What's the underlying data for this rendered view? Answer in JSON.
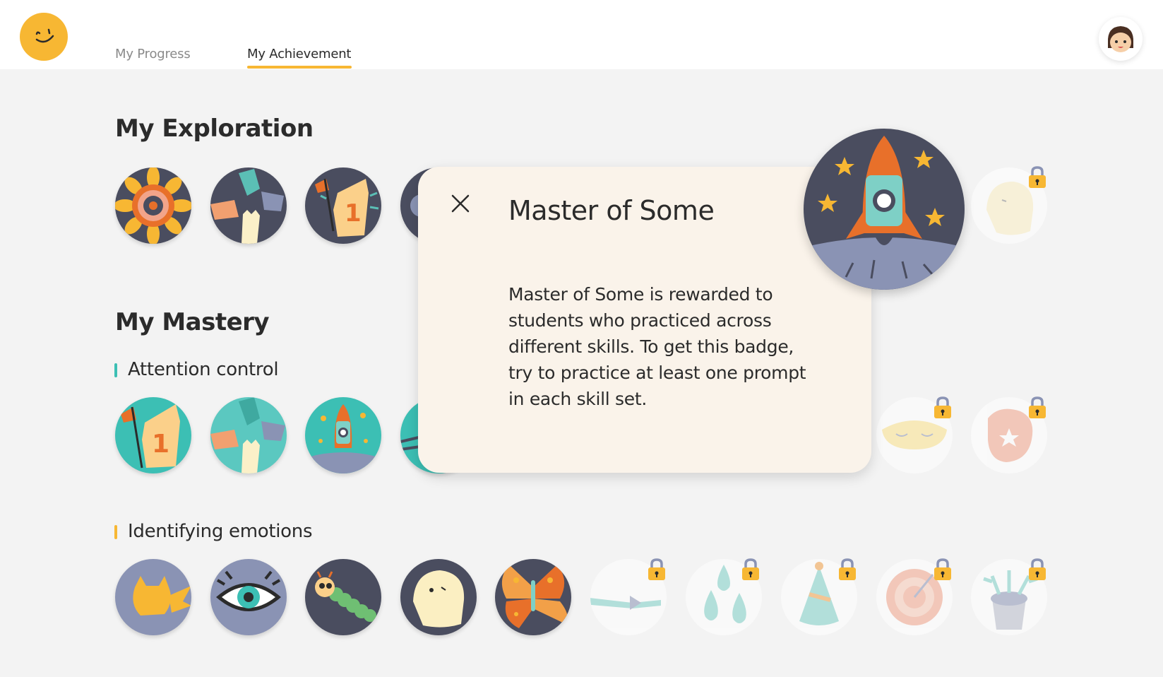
{
  "header": {
    "logo_icon": "smiley-logo-icon",
    "tabs": [
      {
        "label": "My Progress",
        "active": false
      },
      {
        "label": "My Achievement",
        "active": true
      }
    ],
    "avatar_icon": "student-avatar-icon",
    "accent_color": "#f7b733"
  },
  "exploration": {
    "title": "My Exploration",
    "badges": [
      {
        "icon": "sun-target-badge-icon",
        "locked": false
      },
      {
        "icon": "hands-badge-icon",
        "locked": false
      },
      {
        "icon": "foam-finger-badge-icon",
        "locked": false
      },
      {
        "icon": "partially-hidden-badge-icon",
        "locked": false
      },
      {
        "icon": "ghost-badge-icon",
        "locked": true
      }
    ]
  },
  "mastery": {
    "title": "My Mastery",
    "groups": [
      {
        "label": "Attention control",
        "bar_color": "#3cbfb4",
        "badges": [
          {
            "icon": "foam-finger-badge-icon",
            "locked": false
          },
          {
            "icon": "hands-badge-icon",
            "locked": false
          },
          {
            "icon": "rocket-badge-icon",
            "locked": false
          },
          {
            "icon": "partially-hidden-badge-icon",
            "locked": false
          },
          {
            "icon": "sleep-mask-badge-icon",
            "locked": true
          },
          {
            "icon": "boxing-glove-badge-icon",
            "locked": true
          }
        ]
      },
      {
        "label": "Identifying emotions",
        "bar_color": "#f7b733",
        "badges": [
          {
            "icon": "pikachu-badge-icon",
            "locked": false
          },
          {
            "icon": "eye-badge-icon",
            "locked": false
          },
          {
            "icon": "caterpillar-badge-icon",
            "locked": false
          },
          {
            "icon": "ghost-badge-icon",
            "locked": false
          },
          {
            "icon": "butterfly-badge-icon",
            "locked": false
          },
          {
            "icon": "paintbrush-badge-icon",
            "locked": true
          },
          {
            "icon": "water-drops-badge-icon",
            "locked": true
          },
          {
            "icon": "party-hat-badge-icon",
            "locked": true
          },
          {
            "icon": "target-badge-icon",
            "locked": true
          },
          {
            "icon": "potted-plant-badge-icon",
            "locked": true
          }
        ]
      }
    ]
  },
  "popup": {
    "title": "Master of Some",
    "description": "Master of Some is rewarded to students who practiced across different skills. To get this badge, try to practice at least one prompt in each skill set.",
    "badge_icon": "rocket-badge-icon",
    "close_icon": "close-icon"
  }
}
